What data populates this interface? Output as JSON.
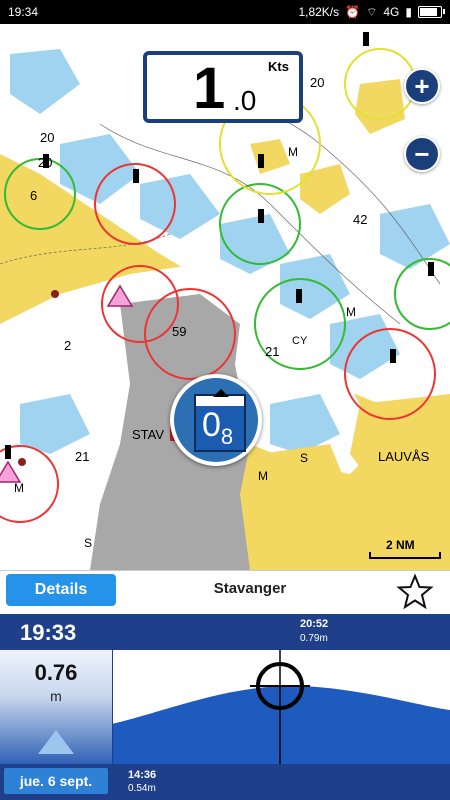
{
  "status_bar": {
    "time": "19:34",
    "net_speed": "1,82K/s",
    "network": "4G",
    "icons": [
      "alarm-icon",
      "wifi-icon",
      "signal-icon",
      "battery-icon"
    ]
  },
  "map": {
    "speed": {
      "unit": "Kts",
      "integer": "1",
      "decimal": ".0"
    },
    "zoom_in": "+",
    "zoom_out": "−",
    "tide_marker": {
      "main": "0",
      "sub": "8"
    },
    "scale_label": "2 NM",
    "labels": {
      "stav": "STAV",
      "lauvas": "LAUVÅS",
      "d_20_8_top": "20",
      "d_20_8_left": "20",
      "d_20_8_mid": "20",
      "d_6": "6",
      "d_42": "42",
      "d_59": "59",
      "d_21_8": "21",
      "d_2_8": "2",
      "d_21_8_low": "21",
      "m1": "M",
      "m2": "M",
      "m3": "M",
      "m4": "M",
      "s1": "S",
      "s2": "S",
      "cy": "CY",
      "sub8": "8"
    }
  },
  "bar": {
    "details_label": "Details",
    "location": "Stavanger"
  },
  "tide": {
    "current_time": "19:33",
    "high_time": "20:52",
    "high_value": "0.79m",
    "level": "0.76",
    "level_unit": "m",
    "date_label": "jue. 6 sept.",
    "low_time": "14:36",
    "low_value": "0.54m",
    "colors": {
      "bar": "#1f3f8a",
      "water": "#1f5bbf"
    }
  }
}
